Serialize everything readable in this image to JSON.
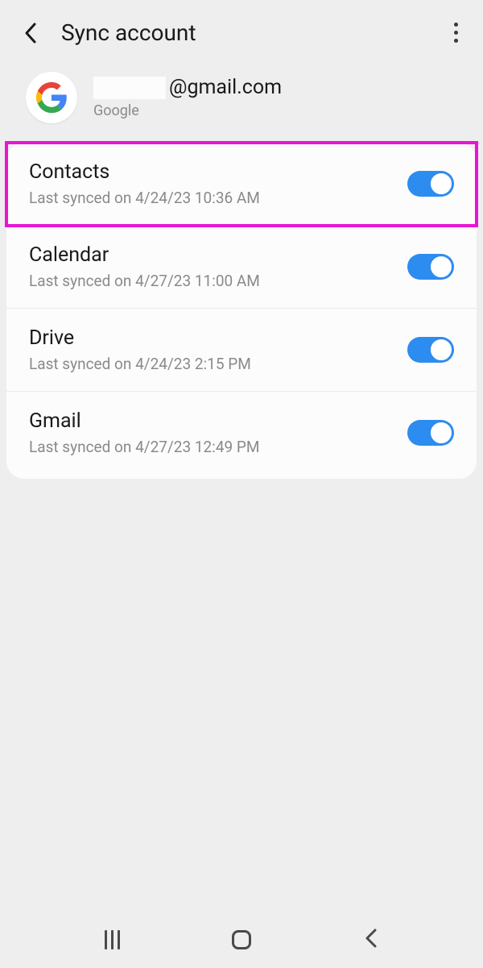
{
  "header": {
    "title": "Sync account"
  },
  "account": {
    "email_domain": "@gmail.com",
    "provider": "Google"
  },
  "items": [
    {
      "title": "Contacts",
      "subtitle": "Last synced on 4/24/23  10:36 AM",
      "highlighted": true
    },
    {
      "title": "Calendar",
      "subtitle": "Last synced on 4/27/23  11:00 AM",
      "highlighted": false
    },
    {
      "title": "Drive",
      "subtitle": "Last synced on 4/24/23  2:15 PM",
      "highlighted": false
    },
    {
      "title": "Gmail",
      "subtitle": "Last synced on 4/27/23  12:49 PM",
      "highlighted": false
    }
  ]
}
